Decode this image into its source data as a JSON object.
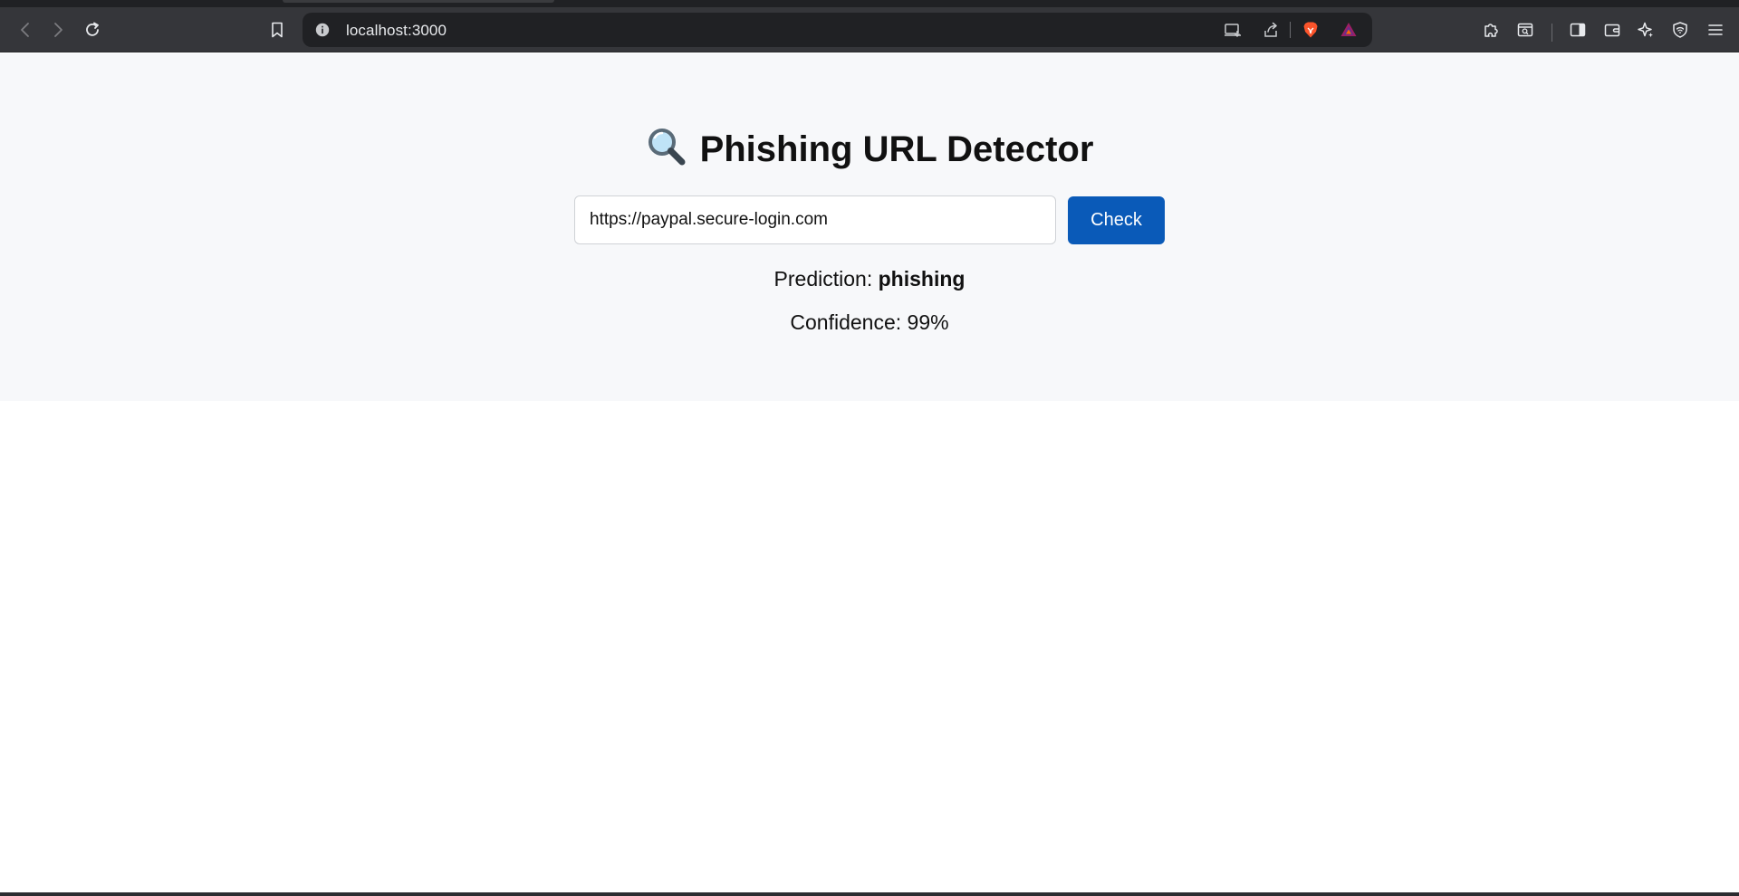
{
  "browser": {
    "url": "localhost:3000"
  },
  "page": {
    "title": "Phishing URL Detector",
    "title_icon": "magnifying-glass-icon",
    "input_value": "https://paypal.secure-login.com",
    "check_label": "Check",
    "prediction_label": "Prediction:",
    "prediction_value": "phishing",
    "confidence_label": "Confidence:",
    "confidence_value": "99%"
  },
  "colors": {
    "primary_button": "#0a5ab8",
    "hero_background": "#f7f8fa",
    "toolbar_background": "#35363a"
  }
}
